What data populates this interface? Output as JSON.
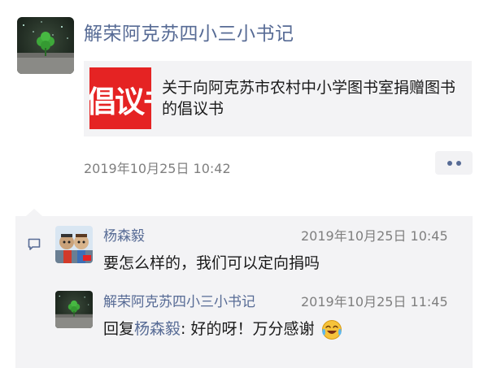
{
  "post": {
    "author": "解荣阿克苏四小三小书记",
    "link": {
      "thumb_text": "倡议书",
      "title": "关于向阿克苏市农村中小学图书室捐赠图书的倡议书"
    },
    "time": "2019年10月25日 10:42"
  },
  "comments": [
    {
      "name": "杨森毅",
      "time": "2019年10月25日 10:45",
      "text": "要怎么样的，我们可以定向捐吗"
    },
    {
      "name": "解荣阿克苏四小三小书记",
      "time": "2019年10月25日 11:45",
      "reply_prefix": "回复",
      "reply_to": "杨森毅",
      "reply_text": ": 好的呀！万分感谢",
      "emoji": "crying-laughing-icon"
    }
  ],
  "colors": {
    "link": "#576b95",
    "thumb": "#e52323",
    "card_bg": "#f3f3f5"
  }
}
